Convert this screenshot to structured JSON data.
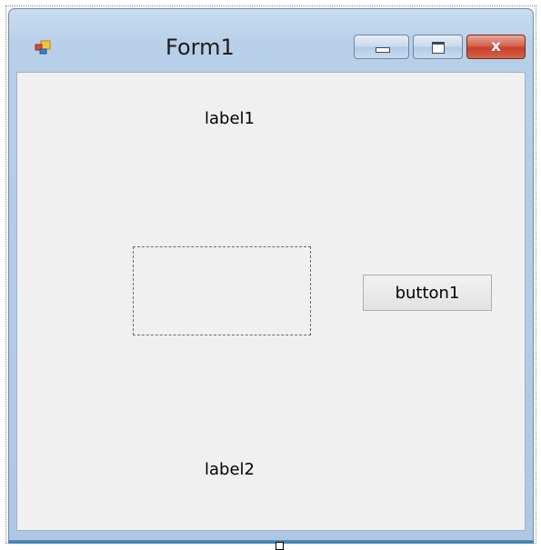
{
  "window": {
    "title": "Form1",
    "icon": "form-app-icon",
    "controls": {
      "minimize_icon": "minimize-icon",
      "maximize_icon": "maximize-icon",
      "close_glyph": "x"
    }
  },
  "form": {
    "label1": "label1",
    "label2": "label2",
    "button1": "button1",
    "picture_box": "dashed-empty-control"
  },
  "colors": {
    "client_background": "#f0f0f0",
    "frame_gradient": "#b7cfe8",
    "close_button": "#c4402a"
  }
}
